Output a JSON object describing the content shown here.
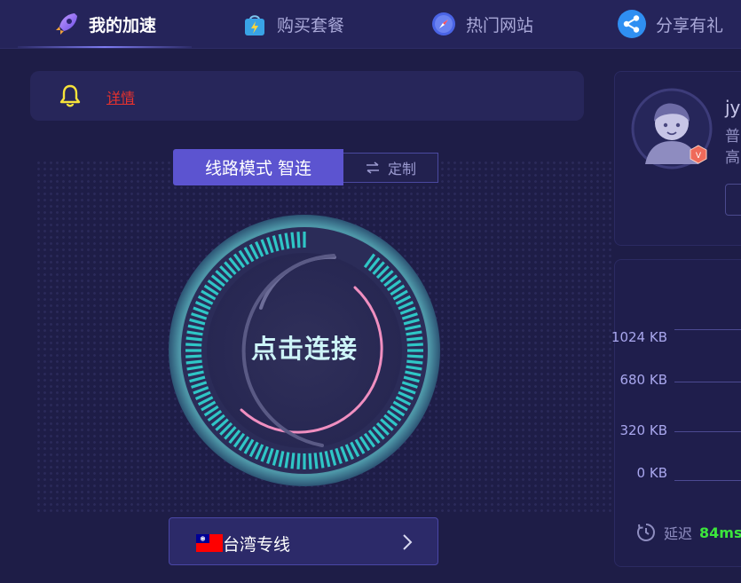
{
  "nav": {
    "tabs": [
      {
        "label": "我的加速",
        "icon": "rocket-icon",
        "active": true
      },
      {
        "label": "购买套餐",
        "icon": "shopping-bag-icon",
        "active": false
      },
      {
        "label": "热门网站",
        "icon": "compass-icon",
        "active": false
      },
      {
        "label": "分享有礼",
        "icon": "share-icon",
        "active": false
      }
    ]
  },
  "notice": {
    "link_text": "详情",
    "icon": "bell-icon"
  },
  "mode": {
    "label": "线路模式 智连",
    "custom_label": "定制"
  },
  "connect": {
    "label": "点击连接"
  },
  "line": {
    "label": "台湾专线",
    "flag": "taiwan-flag"
  },
  "user": {
    "name": "jyx",
    "type": "普",
    "level": "高",
    "avatar": "avatar-icon",
    "badge": "V"
  },
  "traffic": {
    "ticks": [
      "1024 KB",
      "680 KB",
      "320 KB",
      "0 KB"
    ],
    "latency_label": "延迟",
    "latency_value": "84ms"
  },
  "colors": {
    "accent": "#5c54d0",
    "ring": "#2fc6c6",
    "arc": "#f08fc0",
    "latency": "#3ce63c",
    "link": "#e5322e"
  }
}
